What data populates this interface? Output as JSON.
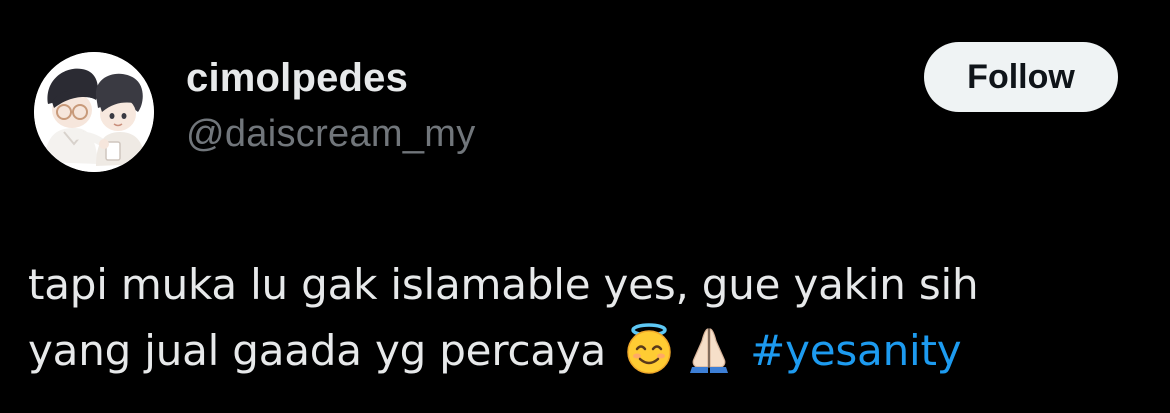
{
  "user": {
    "display_name": "cimolpedes",
    "handle": "@daiscream_my",
    "avatar_icon": "avatar-illustration"
  },
  "follow_button": {
    "label": "Follow"
  },
  "tweet": {
    "line1": "tapi muka lu gak islamable yes, gue yakin sih",
    "line2": "yang jual gaada yg percaya",
    "emojis": [
      "smiling-face-with-halo-icon",
      "folded-hands-icon"
    ],
    "hashtag": "#yesanity"
  },
  "colors": {
    "background": "#000000",
    "primary_text": "#e7e9ea",
    "secondary_text": "#71767b",
    "hashtag": "#1d9bf0",
    "follow_bg": "#eff3f4",
    "follow_text": "#0f1419"
  }
}
